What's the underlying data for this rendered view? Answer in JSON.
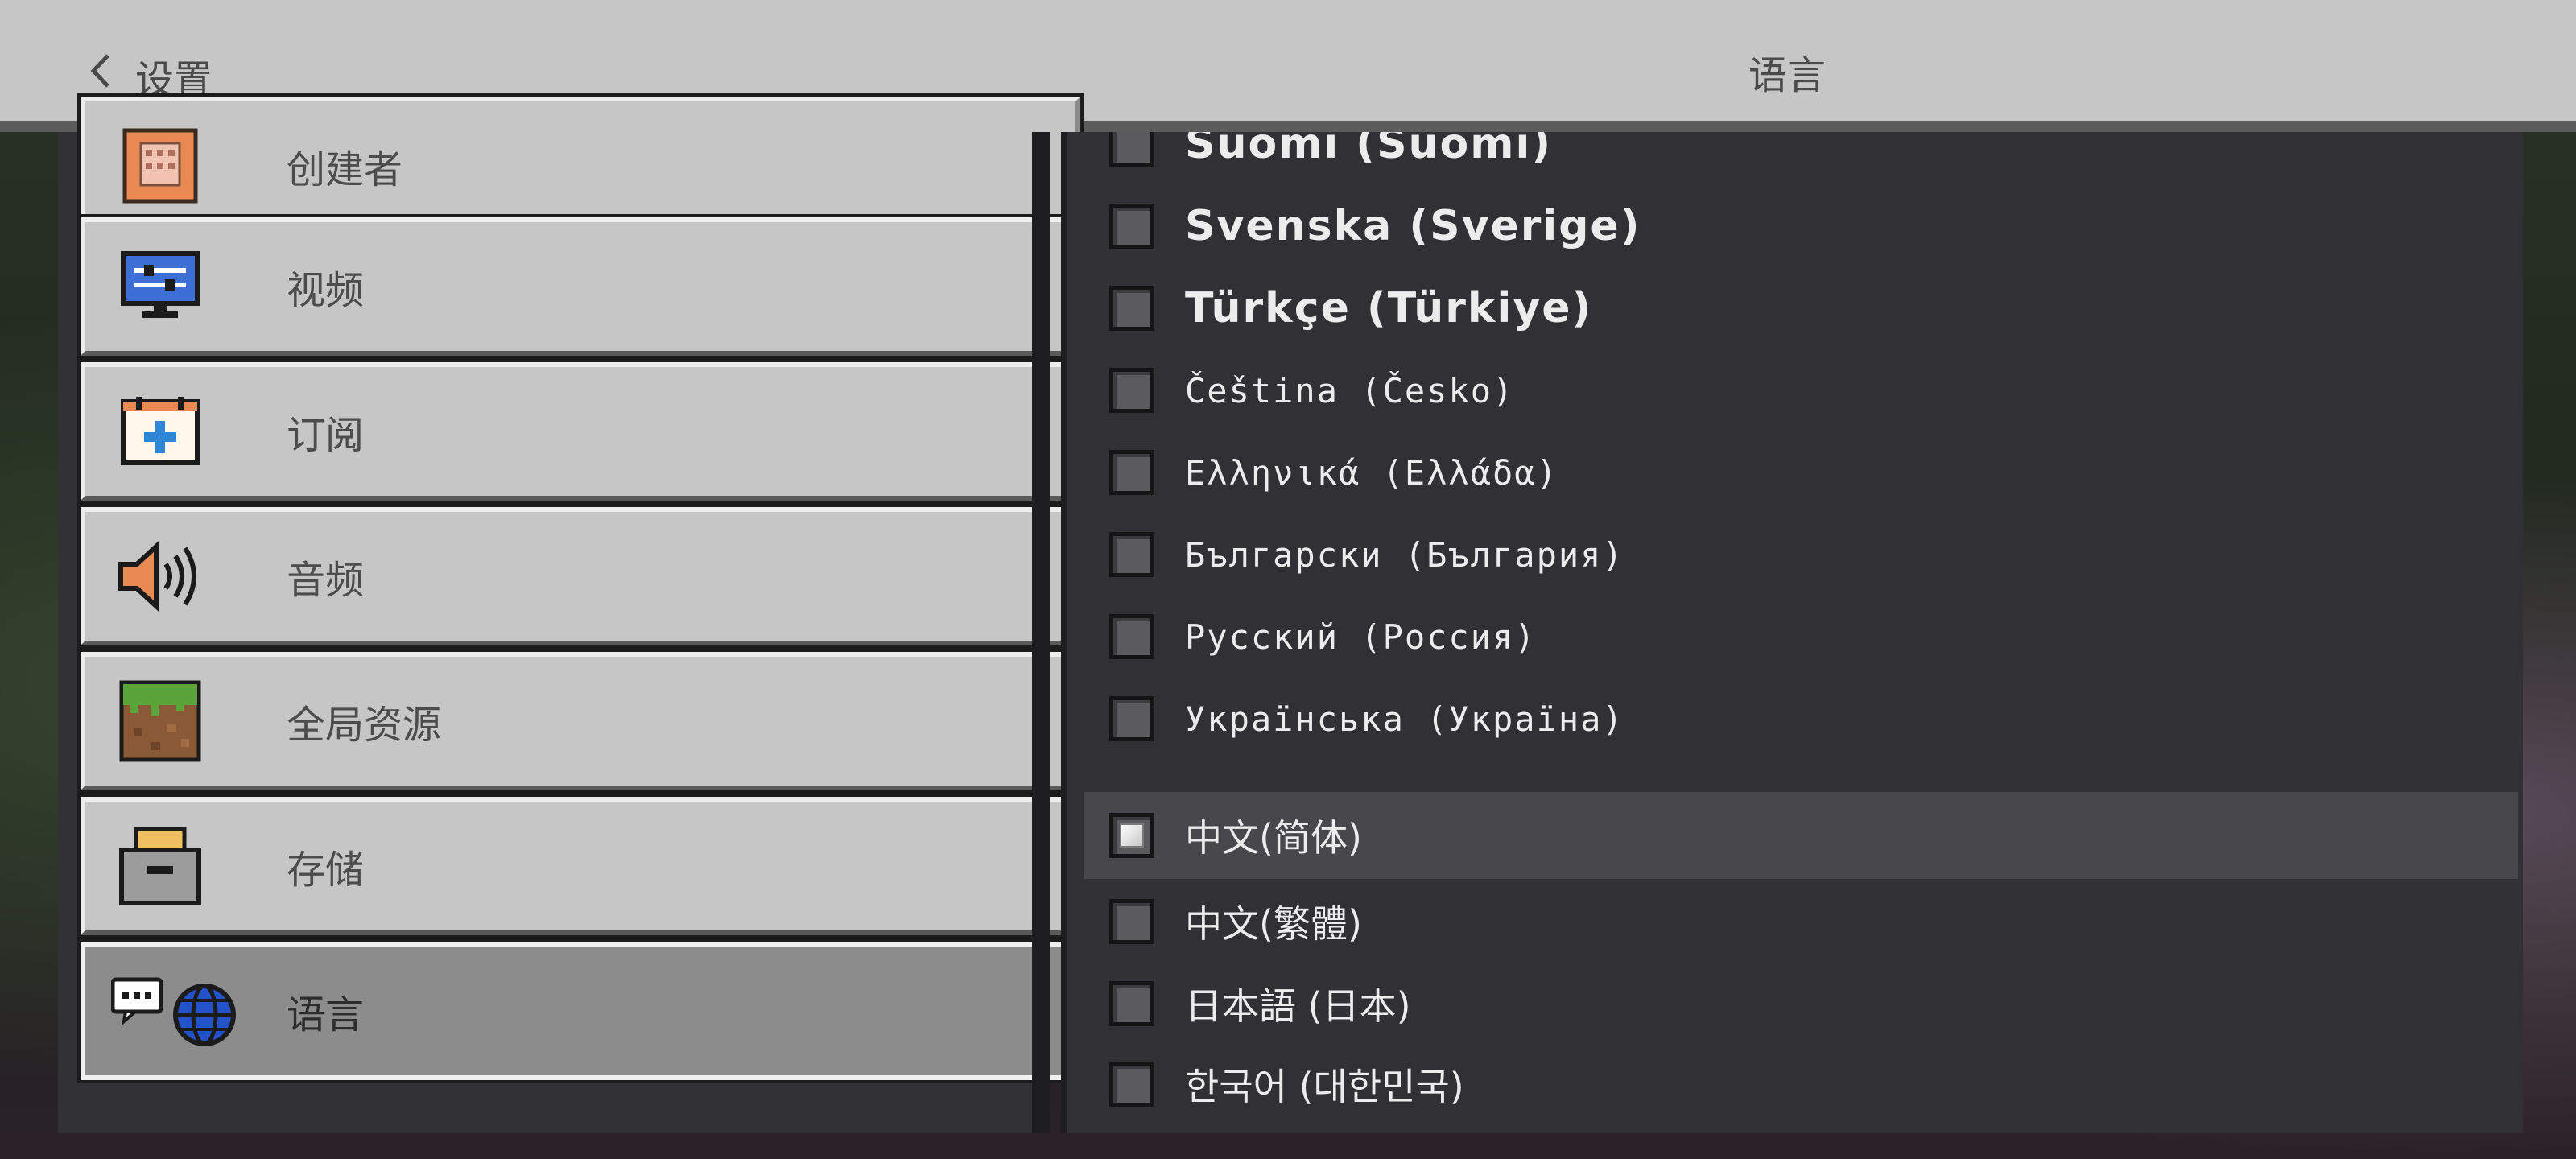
{
  "header": {
    "back_label": "设置",
    "title": "语言"
  },
  "categories": [
    {
      "label": "创建者",
      "icon": "creator-icon",
      "selected": false
    },
    {
      "label": "视频",
      "icon": "video-monitor-icon",
      "selected": false
    },
    {
      "label": "订阅",
      "icon": "subscription-calendar-icon",
      "selected": false
    },
    {
      "label": "音频",
      "icon": "speaker-icon",
      "selected": false
    },
    {
      "label": "全局资源",
      "icon": "grass-block-icon",
      "selected": false
    },
    {
      "label": "存储",
      "icon": "storage-box-icon",
      "selected": false
    },
    {
      "label": "语言",
      "icon": "language-globe-icon",
      "selected": true
    }
  ],
  "languages": [
    {
      "label": "Suomi (Suomi)",
      "checked": false
    },
    {
      "label": "Svenska (Sverige)",
      "checked": false
    },
    {
      "label": "Türkçe (Türkiye)",
      "checked": false
    },
    {
      "label": "Čeština (Česko)",
      "checked": false
    },
    {
      "label": "Ελληνικά (Ελλάδα)",
      "checked": false
    },
    {
      "label": "Български (България)",
      "checked": false
    },
    {
      "label": "Русский (Россия)",
      "checked": false
    },
    {
      "label": "Українська (Україна)",
      "checked": false
    },
    {
      "label": "中文(简体)",
      "checked": true
    },
    {
      "label": "中文(繁體)",
      "checked": false
    },
    {
      "label": "日本語 (日本)",
      "checked": false
    },
    {
      "label": "한국어 (대한민국)",
      "checked": false
    }
  ],
  "colors": {
    "header_bg": "#c6c6c6",
    "panel_bg": "#313135",
    "button_bg": "#c6c6c6",
    "selected_button_bg": "#8c8c8c",
    "selected_row_bg": "#48474b"
  }
}
